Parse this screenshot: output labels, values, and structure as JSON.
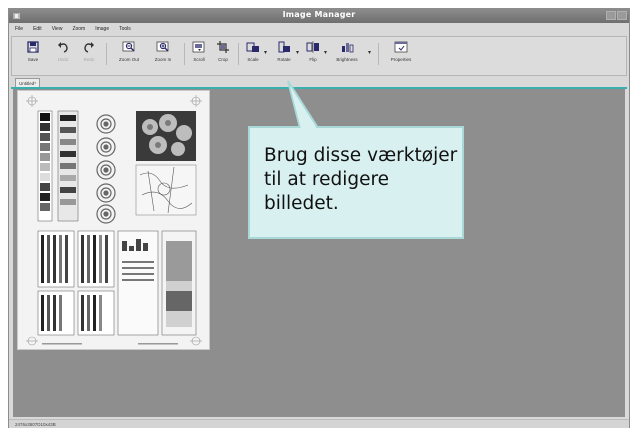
{
  "window": {
    "title": "Image Manager"
  },
  "menu": [
    "File",
    "Edit",
    "View",
    "Zoom",
    "Image",
    "Tools"
  ],
  "toolbar": {
    "buttons": [
      {
        "id": "save",
        "label": "Save",
        "icon": "save-icon",
        "enabled": true
      },
      {
        "id": "undo",
        "label": "Undo",
        "icon": "undo-icon",
        "enabled": false
      },
      {
        "id": "redo",
        "label": "Redo",
        "icon": "redo-icon",
        "enabled": false
      },
      {
        "id": "zoom-out",
        "label": "Zoom Out",
        "icon": "zoom-out-icon",
        "enabled": true
      },
      {
        "id": "zoom-in",
        "label": "Zoom In",
        "icon": "zoom-in-icon",
        "enabled": true
      },
      {
        "id": "scroll",
        "label": "Scroll",
        "icon": "scroll-icon",
        "enabled": true
      },
      {
        "id": "crop",
        "label": "Crop",
        "icon": "crop-icon",
        "enabled": true
      },
      {
        "id": "scale",
        "label": "Scale",
        "icon": "scale-icon",
        "enabled": true
      },
      {
        "id": "rotate",
        "label": "Rotate",
        "icon": "rotate-icon",
        "enabled": true
      },
      {
        "id": "flip",
        "label": "Flip",
        "icon": "flip-icon",
        "enabled": true
      },
      {
        "id": "brightness",
        "label": "Brightness",
        "icon": "brightness-icon",
        "enabled": true
      },
      {
        "id": "properties",
        "label": "Properties",
        "icon": "properties-icon",
        "enabled": true
      }
    ]
  },
  "tab": {
    "label": "Untitled*"
  },
  "status": {
    "text": "2476x3507D10x43B"
  },
  "callout": {
    "text": "Brug disse værktøjer til at redigere billedet."
  },
  "colors": {
    "canvas": "#8e8e8e",
    "accent_line": "#38b0b0",
    "callout_fill": "#d9f0f0",
    "callout_border": "#a8d8d8"
  }
}
